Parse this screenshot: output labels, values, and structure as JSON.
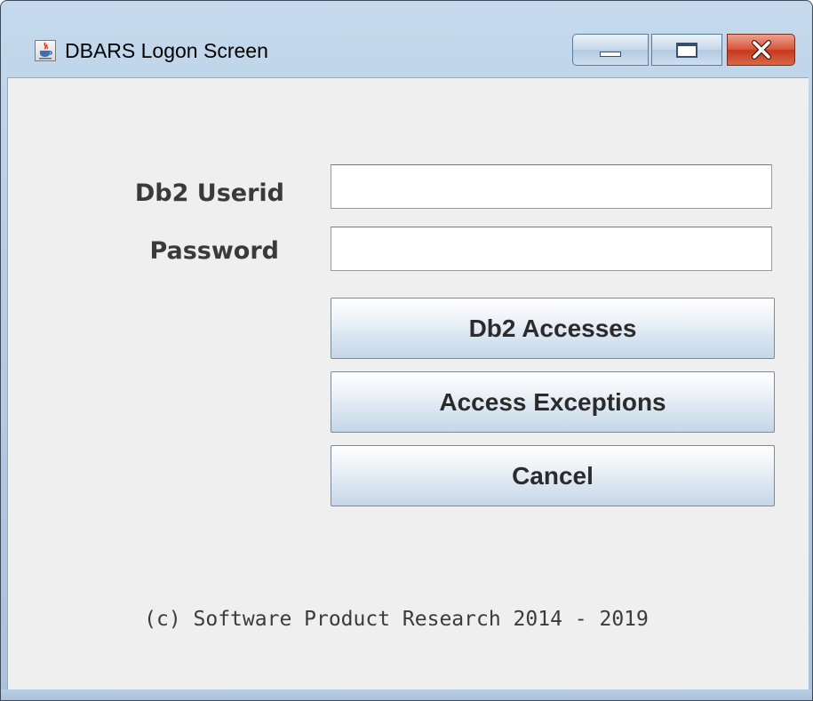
{
  "window": {
    "title": "DBARS Logon Screen",
    "icon": "java-cup-icon"
  },
  "titlebar_buttons": {
    "minimize_icon": "minimize-icon",
    "maximize_icon": "maximize-icon",
    "close_icon": "close-icon"
  },
  "form": {
    "userid_label": "Db2 Userid",
    "userid_value": "",
    "password_label": "Password",
    "password_value": ""
  },
  "buttons": {
    "accesses_label": "Db2 Accesses",
    "exceptions_label": "Access Exceptions",
    "cancel_label": "Cancel"
  },
  "footer": {
    "copyright": "(c) Software Product Research 2014 - 2019"
  },
  "colors": {
    "close_button": "#c7381c",
    "client_background": "#efefef",
    "title_gradient": "#b6cde4"
  }
}
